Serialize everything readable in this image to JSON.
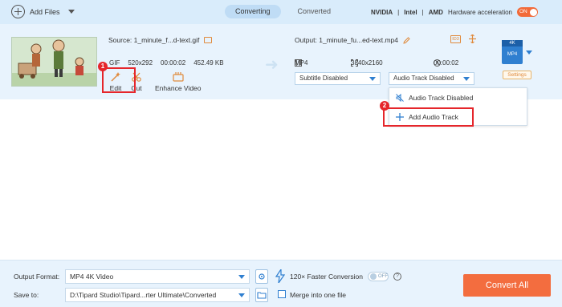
{
  "toolbar": {
    "add_files_label": "Add Files",
    "tabs": [
      {
        "label": "Converting",
        "active": true
      },
      {
        "label": "Converted",
        "active": false
      }
    ],
    "hw": {
      "nvidia": "NVIDIA",
      "intel": "Intel",
      "amd": "AMD",
      "label": "Hardware acceleration",
      "toggle": "ON"
    }
  },
  "file": {
    "source_name": "Source: 1_minute_f...d-text.gif",
    "source_format": "GIF",
    "source_resolution": "520x292",
    "source_duration": "00:00:02",
    "source_size": "452.49 KB",
    "tools": {
      "edit": "Edit",
      "cut": "Cut",
      "enhance": "Enhance Video"
    },
    "output_name": "Output: 1_minute_fu...ed-text.mp4",
    "output_format": "MP4",
    "output_resolution": "3840x2160",
    "output_duration": "00:00:02",
    "subtitle_select": "Subtitle Disabled",
    "audio_select": "Audio Track Disabled",
    "format_badge_top": "4K",
    "format_badge_bottom": "MP4",
    "settings_label": "Settings"
  },
  "callouts": {
    "one": "1",
    "two": "2"
  },
  "audio_menu": {
    "items": [
      {
        "label": "Audio Track Disabled"
      },
      {
        "label": "Add Audio Track"
      }
    ]
  },
  "bottom": {
    "output_format_label": "Output Format:",
    "output_format_value": "MP4 4K Video",
    "faster_label": "120× Faster Conversion",
    "faster_toggle": "OFF",
    "save_to_label": "Save to:",
    "save_to_value": "D:\\Tipard Studio\\Tipard...rter Ultimate\\Converted",
    "merge_label": "Merge into one file",
    "convert_label": "Convert All"
  },
  "colors": {
    "accent": "#2f7fd0",
    "convert": "#f36d3f",
    "callout": "#e5262b"
  }
}
